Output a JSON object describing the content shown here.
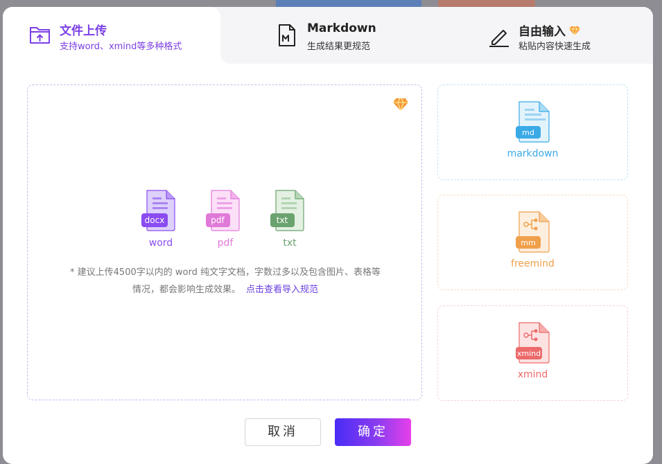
{
  "tabs": [
    {
      "title": "文件上传",
      "subtitle": "支持word、xmind等多种格式",
      "icon": "folder-upload-icon",
      "active": true
    },
    {
      "title": "Markdown",
      "subtitle": "生成结果更规范",
      "icon": "markdown-file-icon",
      "active": false
    },
    {
      "title": "自由输入",
      "subtitle": "粘贴内容快速生成",
      "icon": "pen-icon",
      "active": false,
      "badge": "gem-icon"
    }
  ],
  "upload": {
    "file_types": [
      {
        "tag": "docx",
        "label": "word",
        "color": "#8a4cf0"
      },
      {
        "tag": "pdf",
        "label": "pdf",
        "color": "#e07ad9"
      },
      {
        "tag": "txt",
        "label": "txt",
        "color": "#6aa36f"
      }
    ],
    "hint_line1": "* 建议上传4500字以内的 word 纯文字文档，字数过多以及包含图片、表格等",
    "hint_line2": "情况，都会影响生成效果。",
    "hint_link": "点击查看导入规范"
  },
  "side_cards": [
    {
      "tag": "md",
      "label": "markdown",
      "color": "#3aa9e6"
    },
    {
      "tag": "mm",
      "label": "freemind",
      "color": "#f0a04b"
    },
    {
      "tag": "xmind",
      "label": "xmind",
      "color": "#ec6a6a"
    }
  ],
  "buttons": {
    "cancel": "取消",
    "ok": "确定"
  },
  "colors": {
    "accent": "#7b3fe4",
    "link": "#6b3ee0"
  }
}
